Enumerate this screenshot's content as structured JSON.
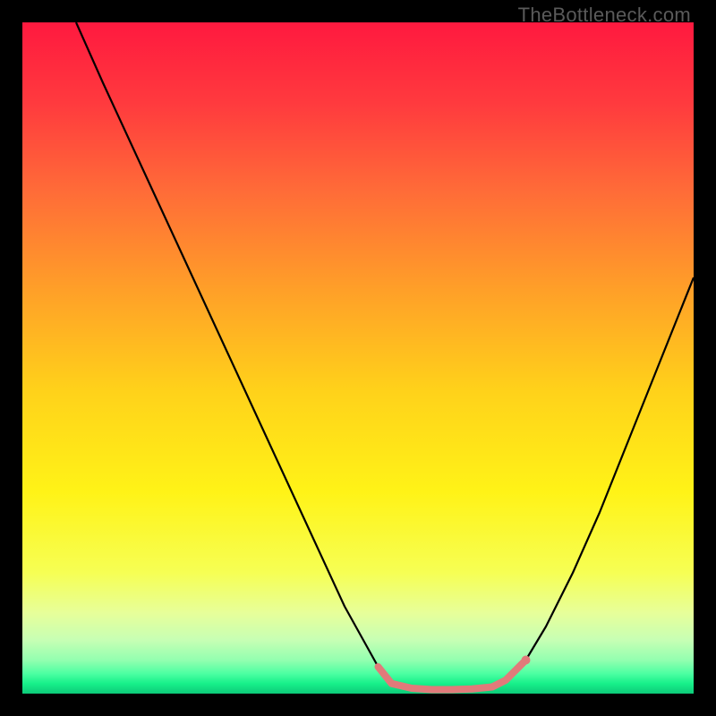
{
  "watermark": "TheBottleneck.com",
  "chart_data": {
    "type": "line",
    "title": "",
    "xlabel": "",
    "ylabel": "",
    "xlim": [
      0,
      100
    ],
    "ylim": [
      0,
      100
    ],
    "background": {
      "type": "vertical-gradient",
      "stops": [
        {
          "pos": 0.0,
          "color": "#ff193f"
        },
        {
          "pos": 0.12,
          "color": "#ff3a3e"
        },
        {
          "pos": 0.25,
          "color": "#ff6b38"
        },
        {
          "pos": 0.4,
          "color": "#ffa028"
        },
        {
          "pos": 0.55,
          "color": "#ffd21a"
        },
        {
          "pos": 0.7,
          "color": "#fff317"
        },
        {
          "pos": 0.82,
          "color": "#f6ff54"
        },
        {
          "pos": 0.88,
          "color": "#e7ff9a"
        },
        {
          "pos": 0.92,
          "color": "#c7ffb4"
        },
        {
          "pos": 0.95,
          "color": "#93ffb0"
        },
        {
          "pos": 0.97,
          "color": "#4dffa2"
        },
        {
          "pos": 0.985,
          "color": "#17f08a"
        },
        {
          "pos": 1.0,
          "color": "#0dca79"
        }
      ]
    },
    "series": [
      {
        "name": "left-branch",
        "color": "#000000",
        "width": 2.2,
        "x": [
          8,
          12,
          18,
          24,
          30,
          36,
          42,
          48,
          53
        ],
        "y": [
          100,
          91,
          78,
          65,
          52,
          39,
          26,
          13,
          4
        ]
      },
      {
        "name": "plateau-segment",
        "color": "#e17a7a",
        "width": 8,
        "linecap": "round",
        "x": [
          53,
          55,
          58,
          61,
          64,
          67,
          70,
          72,
          73.5,
          75
        ],
        "y": [
          4,
          1.5,
          0.8,
          0.6,
          0.6,
          0.7,
          1.0,
          2.0,
          3.5,
          5.0
        ]
      },
      {
        "name": "right-branch",
        "color": "#000000",
        "width": 2.2,
        "x": [
          75,
          78,
          82,
          86,
          90,
          94,
          98,
          100
        ],
        "y": [
          5,
          10,
          18,
          27,
          37,
          47,
          57,
          62
        ]
      }
    ],
    "markers": [
      {
        "name": "plateau-end-dot",
        "x": 75,
        "y": 5,
        "r": 5,
        "color": "#e17a7a"
      }
    ]
  }
}
